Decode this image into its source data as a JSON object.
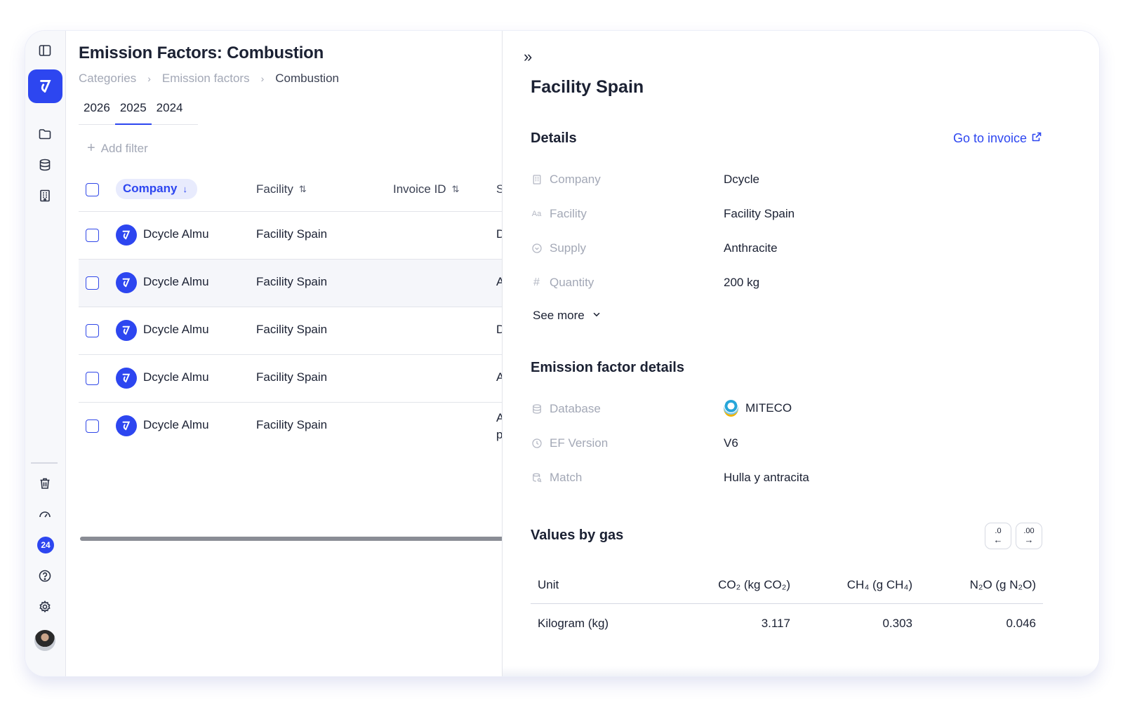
{
  "sidebar": {
    "notification_count": "24",
    "icons": [
      "sidebar-toggle-icon",
      "app-logo-icon",
      "folder-icon",
      "database-icon",
      "building-icon",
      "trash-icon",
      "gauge-icon",
      "help-icon",
      "gear-icon"
    ]
  },
  "page": {
    "title": "Emission Factors: Combustion",
    "breadcrumb": [
      "Categories",
      "Emission factors",
      "Combustion"
    ],
    "year_tabs": [
      "2026",
      "2025",
      "2024"
    ],
    "active_year": "2025",
    "add_filter_label": "Add filter"
  },
  "table": {
    "columns": [
      "Company",
      "Facility",
      "Invoice ID",
      "S"
    ],
    "sorted_column": "Company",
    "rows": [
      {
        "company": "Dcycle Almu",
        "facility": "Facility Spain",
        "cut": "D",
        "cut2": ""
      },
      {
        "company": "Dcycle Almu",
        "facility": "Facility Spain",
        "cut": "A",
        "cut2": ""
      },
      {
        "company": "Dcycle Almu",
        "facility": "Facility Spain",
        "cut": "D",
        "cut2": ""
      },
      {
        "company": "Dcycle Almu",
        "facility": "Facility Spain",
        "cut": "A",
        "cut2": ""
      },
      {
        "company": "Dcycle Almu",
        "facility": "Facility Spain",
        "cut": "A",
        "cut2": "p"
      }
    ]
  },
  "drawer": {
    "title": "Facility Spain",
    "details_title": "Details",
    "go_to_invoice": "Go to invoice",
    "details": [
      {
        "label": "Company",
        "value": "Dcycle"
      },
      {
        "label": "Facility",
        "value": "Facility Spain"
      },
      {
        "label": "Supply",
        "value": "Anthracite"
      },
      {
        "label": "Quantity",
        "value": "200 kg"
      }
    ],
    "see_more": "See more",
    "ef_title": "Emission factor details",
    "ef_details": [
      {
        "label": "Database",
        "value": "MITECO"
      },
      {
        "label": "EF Version",
        "value": "V6"
      },
      {
        "label": "Match",
        "value": "Hulla y antracita"
      }
    ],
    "gas_title": "Values by gas",
    "gas_buttons": [
      ".0",
      ".00"
    ],
    "gas_table": {
      "headers": [
        "Unit",
        "CO₂ (kg CO₂)",
        "CH₄ (g CH₄)",
        "N₂O (g N₂O)"
      ],
      "rows": [
        [
          "Kilogram (kg)",
          "3.117",
          "0.303",
          "0.046"
        ]
      ]
    }
  }
}
